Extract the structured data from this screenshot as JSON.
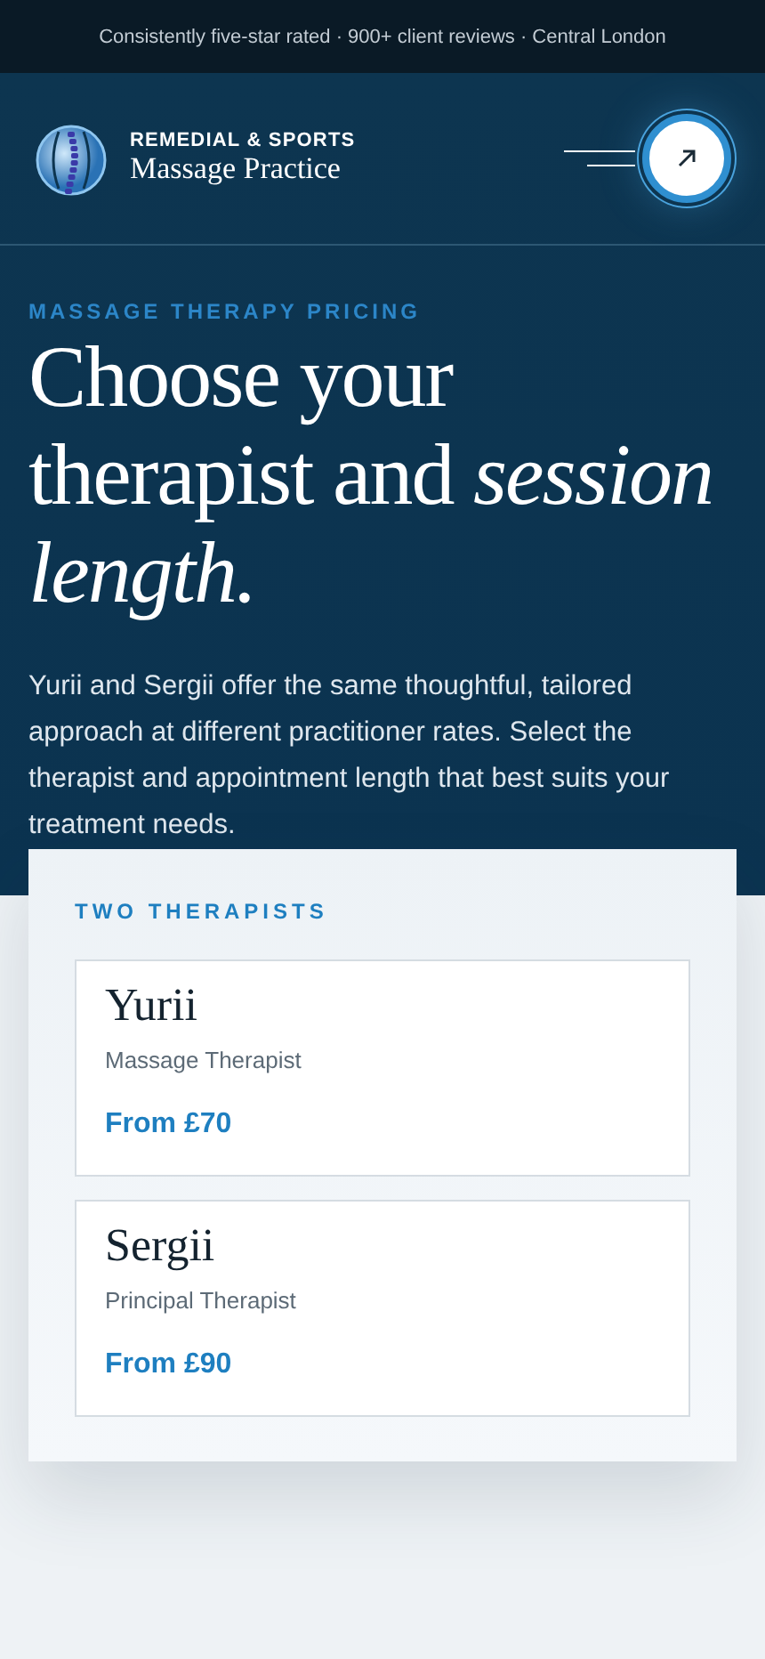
{
  "announcement": "Consistently five-star rated · 900+ client reviews · Central London",
  "brand": {
    "tagline": "REMEDIAL & SPORTS",
    "name": "Massage Practice"
  },
  "hero": {
    "eyebrow": "MASSAGE THERAPY PRICING",
    "title": "Choose your therapist and *session length.*",
    "intro": "Yurii and Sergii offer the same thoughtful, tailored approach at different practitioner rates. Select the therapist and appointment length that best suits your treatment needs."
  },
  "therapists": {
    "heading": "TWO THERAPISTS",
    "items": [
      {
        "name": "Yurii",
        "role": "Massage Therapist",
        "price": "From £70"
      },
      {
        "name": "Sergii",
        "role": "Principal Therapist",
        "price": "From £90"
      }
    ]
  }
}
